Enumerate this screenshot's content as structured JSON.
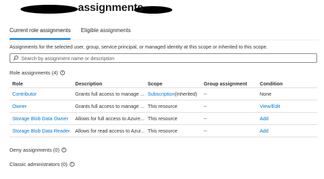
{
  "header": {
    "title": "assignments"
  },
  "tabs": [
    {
      "label": "Current role assignments",
      "active": true
    },
    {
      "label": "Eligible assignments",
      "active": false
    }
  ],
  "description": "Assignments for the selected user, group, service principal, or managed identity at this scope or inherited to this scope.",
  "search": {
    "placeholder": "Search by assignment name or description",
    "value": ""
  },
  "role_assignments": {
    "label": "Role assignments (4)",
    "columns": [
      "Role",
      "Description",
      "Scope",
      "Group assignment",
      "Condition"
    ],
    "rows": [
      {
        "role": "Contributor",
        "description": "Grants full access to manage ...",
        "scope": "Subscription",
        "scope_suffix": " (Inherited)",
        "group": "--",
        "condition": "None"
      },
      {
        "role": "Owner",
        "description": "Grants full access to manage ...",
        "scope": "This resource",
        "scope_suffix": "",
        "group": "--",
        "condition": "View/Edit"
      },
      {
        "role": "Storage Blob Data Owner",
        "description": "Allows for full access to Azure...",
        "scope": "This resource",
        "scope_suffix": "",
        "group": "--",
        "condition": "Add"
      },
      {
        "role": "Storage Blob Data Reader",
        "description": "Allows for read access to Azur...",
        "scope": "This resource",
        "scope_suffix": "",
        "group": "--",
        "condition": "Add"
      }
    ]
  },
  "deny_assignments": {
    "label": "Deny assignments (0)"
  },
  "classic_admins": {
    "label": "Classic administrators (0)"
  },
  "colors": {
    "link": "#0078d4",
    "tab_indicator": "#0078d4",
    "redaction": "#000000"
  },
  "icons": {
    "search": "search-icon",
    "info": "info-icon"
  }
}
